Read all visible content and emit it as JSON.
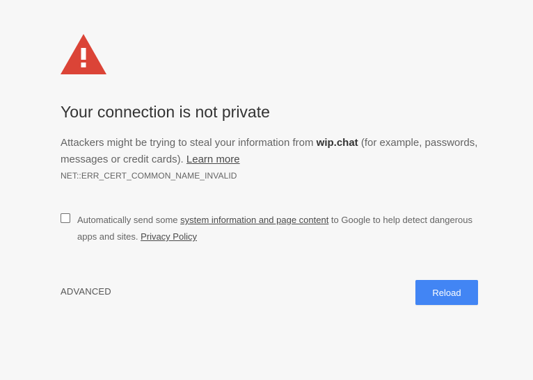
{
  "icon": {
    "name": "warning-icon",
    "color": "#db4437"
  },
  "title": "Your connection is not private",
  "message": {
    "before_domain": "Attackers might be trying to steal your information from ",
    "domain": "wip.chat",
    "after_domain": " (for example, passwords, messages or credit cards). ",
    "learn_more": "Learn more"
  },
  "error_code": "NET::ERR_CERT_COMMON_NAME_INVALID",
  "reporting": {
    "checked": false,
    "before_link": "Automatically send some ",
    "link": "system information and page content",
    "after_link": " to Google to help detect dangerous apps and sites. ",
    "privacy_policy": "Privacy Policy"
  },
  "buttons": {
    "advanced": "ADVANCED",
    "reload": "Reload"
  },
  "colors": {
    "background": "#f7f7f7",
    "primary_button": "#4285f4"
  }
}
